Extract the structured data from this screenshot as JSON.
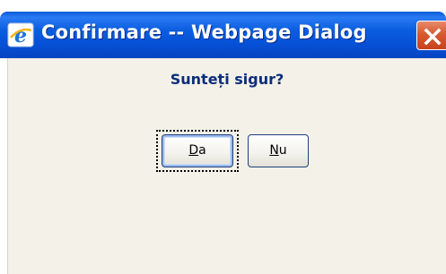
{
  "window": {
    "title": "Confirmare -- Webpage Dialog",
    "icon": "ie-icon",
    "close_icon": "close-icon"
  },
  "dialog": {
    "question": "Sunteți sigur?",
    "buttons": {
      "yes": {
        "accel": "D",
        "rest": "a"
      },
      "no": {
        "accel": "N",
        "rest": "u"
      }
    }
  }
}
